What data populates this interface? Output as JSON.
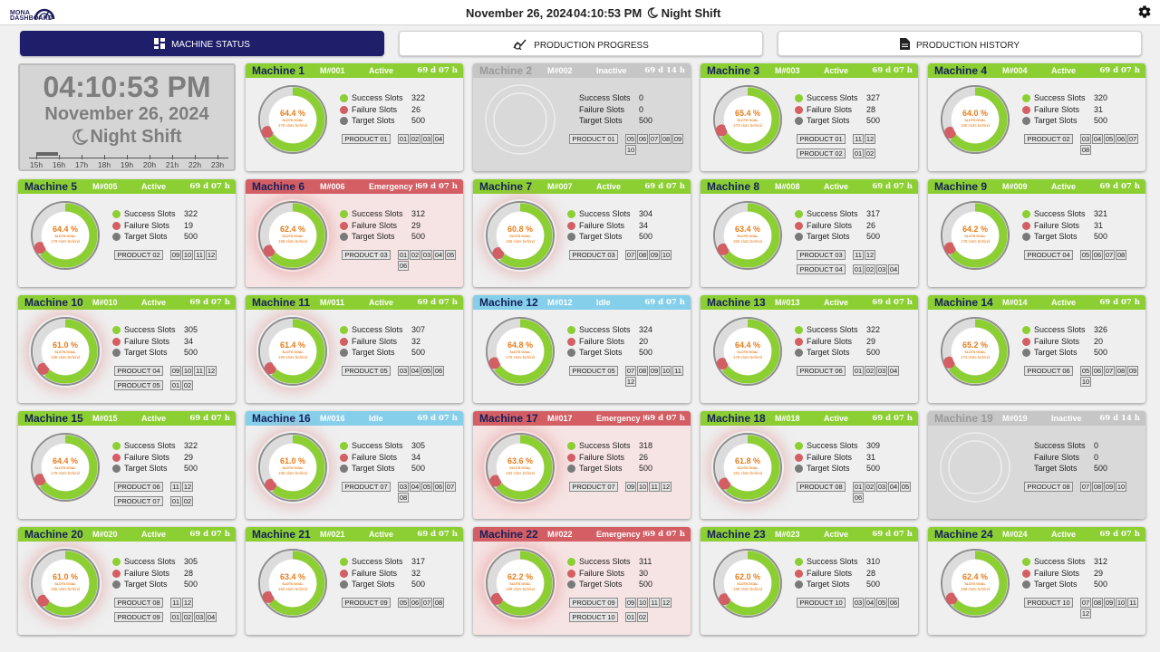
{
  "header": {
    "logo_line1": "MONA",
    "logo_line2": "DASHBOARD",
    "date": "November 26, 2024",
    "time": "04:10:53 PM",
    "shift": "Night Shift"
  },
  "tabs": [
    {
      "label": "MACHINE STATUS",
      "icon": "grid-icon",
      "active": true
    },
    {
      "label": "PRODUCTION PROGRESS",
      "icon": "progress-chart-icon",
      "active": false
    },
    {
      "label": "PRODUCTION HISTORY",
      "icon": "document-icon",
      "active": false
    }
  ],
  "clock": {
    "time": "04:10:53 PM",
    "date": "November 26, 2024",
    "shift": "Night Shift",
    "hours": [
      "15h",
      "16h",
      "17h",
      "18h",
      "19h",
      "20h",
      "21h",
      "22h",
      "23h"
    ],
    "shift_progress_fraction": 0.12
  },
  "labels": {
    "success": "Success Slots",
    "failure": "Failure Slots",
    "target": "Target Slots",
    "goal": "SLOTS GOAL"
  },
  "colors": {
    "active": "#8ccf32",
    "idle": "#86cfeb",
    "emergency": "#d35e64",
    "inactive": "#c6c6c6",
    "success": "#8ccf32",
    "failure": "#d35e64",
    "target": "#7a7a7a",
    "percent_text": "#e67d1c",
    "brand": "#1e1e6b"
  },
  "machines": [
    {
      "name": "Machine 1",
      "id": "M#001",
      "status": "Active",
      "uptime": "69 d 07 h",
      "success": 322,
      "failure": 26,
      "target": 500,
      "percent": "64.4 %",
      "behind": "178 slots behind",
      "products": [
        {
          "name": "PRODUCT 01",
          "slots": [
            "01",
            "02",
            "03",
            "04"
          ]
        }
      ]
    },
    {
      "name": "Machine 2",
      "id": "M#002",
      "status": "Inactive",
      "uptime": "69 d 14 h",
      "success": 0,
      "failure": 0,
      "target": 500,
      "percent": "",
      "behind": "",
      "products": [
        {
          "name": "PRODUCT 01",
          "slots": [
            "05",
            "06",
            "07",
            "08",
            "09",
            "10"
          ]
        }
      ]
    },
    {
      "name": "Machine 3",
      "id": "M#003",
      "status": "Active",
      "uptime": "69 d 07 h",
      "success": 327,
      "failure": 28,
      "target": 500,
      "percent": "65.4 %",
      "behind": "173 slots behind",
      "products": [
        {
          "name": "PRODUCT 01",
          "slots": [
            "11",
            "12"
          ]
        },
        {
          "name": "PRODUCT 02",
          "slots": [
            "01",
            "02"
          ]
        }
      ]
    },
    {
      "name": "Machine 4",
      "id": "M#004",
      "status": "Active",
      "uptime": "69 d 07 h",
      "success": 320,
      "failure": 31,
      "target": 500,
      "percent": "64.0 %",
      "behind": "180 slots behind",
      "products": [
        {
          "name": "PRODUCT 02",
          "slots": [
            "03",
            "04",
            "05",
            "06",
            "07",
            "08"
          ]
        }
      ]
    },
    {
      "name": "Machine 5",
      "id": "M#005",
      "status": "Active",
      "uptime": "69 d 07 h",
      "success": 322,
      "failure": 19,
      "target": 500,
      "percent": "64.4 %",
      "behind": "178 slots behind",
      "products": [
        {
          "name": "PRODUCT 02",
          "slots": [
            "09",
            "10",
            "11",
            "12"
          ]
        }
      ]
    },
    {
      "name": "Machine 6",
      "id": "M#006",
      "status": "Emergency !",
      "uptime": "69 d 07 h",
      "success": 312,
      "failure": 29,
      "target": 500,
      "percent": "62.4 %",
      "behind": "188 slots behind",
      "products": [
        {
          "name": "PRODUCT 03",
          "slots": [
            "01",
            "02",
            "03",
            "04",
            "05",
            "06"
          ]
        }
      ]
    },
    {
      "name": "Machine 7",
      "id": "M#007",
      "status": "Active",
      "uptime": "69 d 07 h",
      "success": 304,
      "failure": 34,
      "target": 500,
      "percent": "60.8 %",
      "behind": "196 slots behind",
      "products": [
        {
          "name": "PRODUCT 03",
          "slots": [
            "07",
            "08",
            "09",
            "10"
          ]
        }
      ]
    },
    {
      "name": "Machine 8",
      "id": "M#008",
      "status": "Active",
      "uptime": "69 d 07 h",
      "success": 317,
      "failure": 26,
      "target": 500,
      "percent": "63.4 %",
      "behind": "183 slots behind",
      "products": [
        {
          "name": "PRODUCT 03",
          "slots": [
            "11",
            "12"
          ]
        },
        {
          "name": "PRODUCT 04",
          "slots": [
            "01",
            "02",
            "03",
            "04"
          ]
        }
      ]
    },
    {
      "name": "Machine 9",
      "id": "M#009",
      "status": "Active",
      "uptime": "69 d 07 h",
      "success": 321,
      "failure": 31,
      "target": 500,
      "percent": "64.2 %",
      "behind": "179 slots behind",
      "products": [
        {
          "name": "PRODUCT 04",
          "slots": [
            "05",
            "06",
            "07",
            "08"
          ]
        }
      ]
    },
    {
      "name": "Machine 10",
      "id": "M#010",
      "status": "Active",
      "uptime": "69 d 07 h",
      "success": 305,
      "failure": 34,
      "target": 500,
      "percent": "61.0 %",
      "behind": "195 slots behind",
      "products": [
        {
          "name": "PRODUCT 04",
          "slots": [
            "09",
            "10",
            "11",
            "12"
          ]
        },
        {
          "name": "PRODUCT 05",
          "slots": [
            "01",
            "02"
          ]
        }
      ]
    },
    {
      "name": "Machine 11",
      "id": "M#011",
      "status": "Active",
      "uptime": "69 d 07 h",
      "success": 307,
      "failure": 32,
      "target": 500,
      "percent": "61.4 %",
      "behind": "193 slots behind",
      "products": [
        {
          "name": "PRODUCT 05",
          "slots": [
            "03",
            "04",
            "05",
            "06"
          ]
        }
      ]
    },
    {
      "name": "Machine 12",
      "id": "M#012",
      "status": "Idle",
      "uptime": "69 d 07 h",
      "success": 324,
      "failure": 20,
      "target": 500,
      "percent": "64.8 %",
      "behind": "176 slots behind",
      "products": [
        {
          "name": "PRODUCT 05",
          "slots": [
            "07",
            "08",
            "09",
            "10",
            "11",
            "12"
          ]
        }
      ]
    },
    {
      "name": "Machine 13",
      "id": "M#013",
      "status": "Active",
      "uptime": "69 d 07 h",
      "success": 322,
      "failure": 29,
      "target": 500,
      "percent": "64.4 %",
      "behind": "178 slots behind",
      "products": [
        {
          "name": "PRODUCT 06",
          "slots": [
            "01",
            "02",
            "03",
            "04"
          ]
        }
      ]
    },
    {
      "name": "Machine 14",
      "id": "M#014",
      "status": "Active",
      "uptime": "69 d 07 h",
      "success": 326,
      "failure": 20,
      "target": 500,
      "percent": "65.2 %",
      "behind": "174 slots behind",
      "products": [
        {
          "name": "PRODUCT 06",
          "slots": [
            "05",
            "06",
            "07",
            "08",
            "09",
            "10"
          ]
        }
      ]
    },
    {
      "name": "Machine 15",
      "id": "M#015",
      "status": "Active",
      "uptime": "69 d 07 h",
      "success": 322,
      "failure": 29,
      "target": 500,
      "percent": "64.4 %",
      "behind": "178 slots behind",
      "products": [
        {
          "name": "PRODUCT 06",
          "slots": [
            "11",
            "12"
          ]
        },
        {
          "name": "PRODUCT 07",
          "slots": [
            "01",
            "02"
          ]
        }
      ]
    },
    {
      "name": "Machine 16",
      "id": "M#016",
      "status": "Idle",
      "uptime": "69 d 07 h",
      "success": 305,
      "failure": 34,
      "target": 500,
      "percent": "61.0 %",
      "behind": "195 slots behind",
      "products": [
        {
          "name": "PRODUCT 07",
          "slots": [
            "03",
            "04",
            "05",
            "06",
            "07",
            "08"
          ]
        }
      ]
    },
    {
      "name": "Machine 17",
      "id": "M#017",
      "status": "Emergency !",
      "uptime": "69 d 07 h",
      "success": 318,
      "failure": 26,
      "target": 500,
      "percent": "63.6 %",
      "behind": "182 slots behind",
      "products": [
        {
          "name": "PRODUCT 07",
          "slots": [
            "09",
            "10",
            "11",
            "12"
          ]
        }
      ]
    },
    {
      "name": "Machine 18",
      "id": "M#018",
      "status": "Active",
      "uptime": "69 d 07 h",
      "success": 309,
      "failure": 31,
      "target": 500,
      "percent": "61.8 %",
      "behind": "191 slots behind",
      "products": [
        {
          "name": "PRODUCT 08",
          "slots": [
            "01",
            "02",
            "03",
            "04",
            "05",
            "06"
          ]
        }
      ]
    },
    {
      "name": "Machine 19",
      "id": "M#019",
      "status": "Inactive",
      "uptime": "69 d 14 h",
      "success": 0,
      "failure": 0,
      "target": 500,
      "percent": "",
      "behind": "",
      "products": [
        {
          "name": "PRODUCT 08",
          "slots": [
            "07",
            "08",
            "09",
            "10"
          ]
        }
      ]
    },
    {
      "name": "Machine 20",
      "id": "M#020",
      "status": "Active",
      "uptime": "69 d 07 h",
      "success": 305,
      "failure": 28,
      "target": 500,
      "percent": "61.0 %",
      "behind": "195 slots behind",
      "products": [
        {
          "name": "PRODUCT 08",
          "slots": [
            "11",
            "12"
          ]
        },
        {
          "name": "PRODUCT 09",
          "slots": [
            "01",
            "02",
            "03",
            "04"
          ]
        }
      ]
    },
    {
      "name": "Machine 21",
      "id": "M#021",
      "status": "Active",
      "uptime": "69 d 07 h",
      "success": 317,
      "failure": 32,
      "target": 500,
      "percent": "63.4 %",
      "behind": "183 slots behind",
      "products": [
        {
          "name": "PRODUCT 09",
          "slots": [
            "05",
            "06",
            "07",
            "08"
          ]
        }
      ]
    },
    {
      "name": "Machine 22",
      "id": "M#022",
      "status": "Emergency !",
      "uptime": "69 d 07 h",
      "success": 311,
      "failure": 30,
      "target": 500,
      "percent": "62.2 %",
      "behind": "189 slots behind",
      "products": [
        {
          "name": "PRODUCT 09",
          "slots": [
            "09",
            "10",
            "11",
            "12"
          ]
        },
        {
          "name": "PRODUCT 10",
          "slots": [
            "01",
            "02"
          ]
        }
      ]
    },
    {
      "name": "Machine 23",
      "id": "M#023",
      "status": "Active",
      "uptime": "69 d 07 h",
      "success": 310,
      "failure": 28,
      "target": 500,
      "percent": "62.0 %",
      "behind": "190 slots behind",
      "products": [
        {
          "name": "PRODUCT 10",
          "slots": [
            "03",
            "04",
            "05",
            "06"
          ]
        }
      ]
    },
    {
      "name": "Machine 24",
      "id": "M#024",
      "status": "Active",
      "uptime": "69 d 07 h",
      "success": 312,
      "failure": 29,
      "target": 500,
      "percent": "62.4 %",
      "behind": "188 slots behind",
      "products": [
        {
          "name": "PRODUCT 10",
          "slots": [
            "07",
            "08",
            "09",
            "10",
            "11",
            "12"
          ]
        }
      ]
    }
  ]
}
